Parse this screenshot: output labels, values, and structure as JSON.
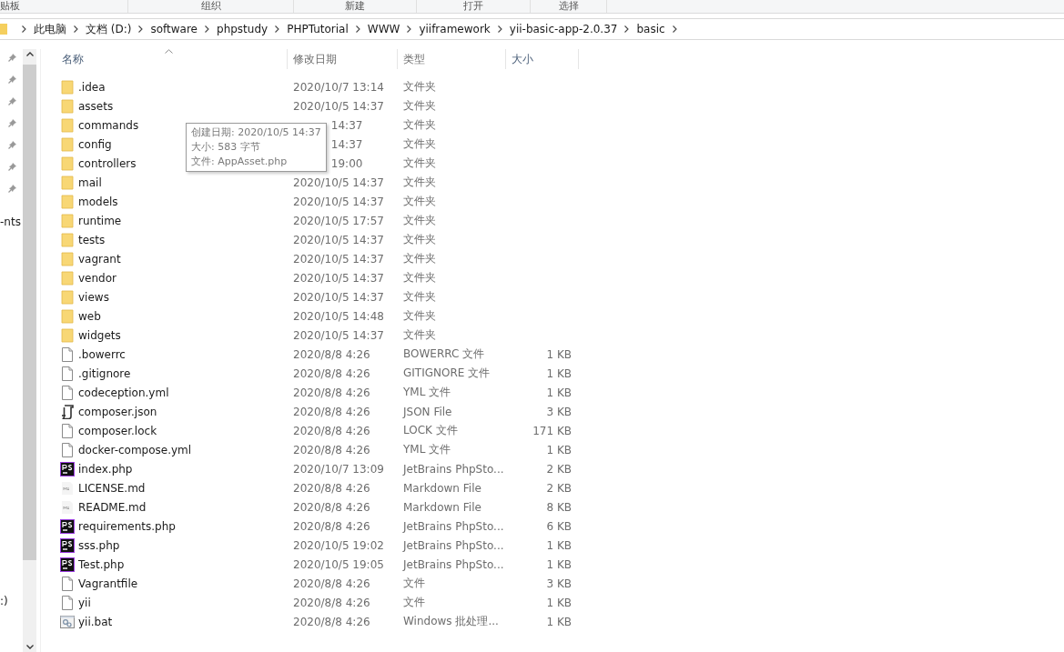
{
  "ribbon": {
    "groups": [
      "贴板",
      "组织",
      "新建",
      "打开",
      "选择"
    ]
  },
  "breadcrumb": [
    "此电脑",
    "文档 (D:)",
    "software",
    "phpstudy",
    "PHPTutorial",
    "WWW",
    "yiiframework",
    "yii-basic-app-2.0.37",
    "basic"
  ],
  "nav_pane": {
    "items": [
      "-nts",
      ":)"
    ]
  },
  "table": {
    "columns": [
      "名称",
      "修改日期",
      "类型",
      "大小"
    ],
    "rows": [
      {
        "kind": "folder",
        "name": ".idea",
        "modified": "2020/10/7 13:14",
        "type": "文件夹"
      },
      {
        "kind": "folder",
        "name": "assets",
        "modified": "2020/10/5 14:37",
        "type": "文件夹"
      },
      {
        "kind": "folder",
        "name": "commands",
        "modified": "14:37",
        "type": "文件夹"
      },
      {
        "kind": "folder",
        "name": "config",
        "modified": "14:37",
        "type": "文件夹"
      },
      {
        "kind": "folder",
        "name": "controllers",
        "modified": "19:00",
        "type": "文件夹"
      },
      {
        "kind": "folder",
        "name": "mail",
        "modified": "2020/10/5 14:37",
        "type": "文件夹"
      },
      {
        "kind": "folder",
        "name": "models",
        "modified": "2020/10/5 14:37",
        "type": "文件夹"
      },
      {
        "kind": "folder",
        "name": "runtime",
        "modified": "2020/10/5 17:57",
        "type": "文件夹"
      },
      {
        "kind": "folder",
        "name": "tests",
        "modified": "2020/10/5 14:37",
        "type": "文件夹"
      },
      {
        "kind": "folder",
        "name": "vagrant",
        "modified": "2020/10/5 14:37",
        "type": "文件夹"
      },
      {
        "kind": "folder",
        "name": "vendor",
        "modified": "2020/10/5 14:37",
        "type": "文件夹"
      },
      {
        "kind": "folder",
        "name": "views",
        "modified": "2020/10/5 14:37",
        "type": "文件夹"
      },
      {
        "kind": "folder",
        "name": "web",
        "modified": "2020/10/5 14:48",
        "type": "文件夹"
      },
      {
        "kind": "folder",
        "name": "widgets",
        "modified": "2020/10/5 14:37",
        "type": "文件夹"
      },
      {
        "kind": "file",
        "name": ".bowerrc",
        "modified": "2020/8/8 4:26",
        "type": "BOWERRC 文件",
        "size": "1 KB"
      },
      {
        "kind": "file",
        "name": ".gitignore",
        "modified": "2020/8/8 4:26",
        "type": "GITIGNORE 文件",
        "size": "1 KB"
      },
      {
        "kind": "file",
        "name": "codeception.yml",
        "modified": "2020/8/8 4:26",
        "type": "YML 文件",
        "size": "1 KB"
      },
      {
        "kind": "script",
        "name": "composer.json",
        "modified": "2020/8/8 4:26",
        "type": "JSON File",
        "size": "3 KB"
      },
      {
        "kind": "file",
        "name": "composer.lock",
        "modified": "2020/8/8 4:26",
        "type": "LOCK 文件",
        "size": "171 KB"
      },
      {
        "kind": "file",
        "name": "docker-compose.yml",
        "modified": "2020/8/8 4:26",
        "type": "YML 文件",
        "size": "1 KB"
      },
      {
        "kind": "phpstorm",
        "name": "index.php",
        "modified": "2020/10/7 13:09",
        "type": "JetBrains PhpSto...",
        "size": "2 KB"
      },
      {
        "kind": "markdown",
        "name": "LICENSE.md",
        "modified": "2020/8/8 4:26",
        "type": "Markdown File",
        "size": "2 KB"
      },
      {
        "kind": "markdown",
        "name": "README.md",
        "modified": "2020/8/8 4:26",
        "type": "Markdown File",
        "size": "8 KB"
      },
      {
        "kind": "phpstorm",
        "name": "requirements.php",
        "modified": "2020/8/8 4:26",
        "type": "JetBrains PhpSto...",
        "size": "6 KB"
      },
      {
        "kind": "phpstorm",
        "name": "sss.php",
        "modified": "2020/10/5 19:02",
        "type": "JetBrains PhpSto...",
        "size": "1 KB"
      },
      {
        "kind": "phpstorm",
        "name": "Test.php",
        "modified": "2020/10/5 19:05",
        "type": "JetBrains PhpSto...",
        "size": "1 KB"
      },
      {
        "kind": "file",
        "name": "Vagrantfile",
        "modified": "2020/8/8 4:26",
        "type": "文件",
        "size": "3 KB"
      },
      {
        "kind": "file",
        "name": "yii",
        "modified": "2020/8/8 4:26",
        "type": "文件",
        "size": "1 KB"
      },
      {
        "kind": "batch",
        "name": "yii.bat",
        "modified": "2020/8/8 4:26",
        "type": "Windows 批处理...",
        "size": "1 KB"
      }
    ]
  },
  "tooltip": {
    "lines": [
      "创建日期: 2020/10/5 14:37",
      "大小: 583 字节",
      "文件: AppAsset.php"
    ]
  }
}
